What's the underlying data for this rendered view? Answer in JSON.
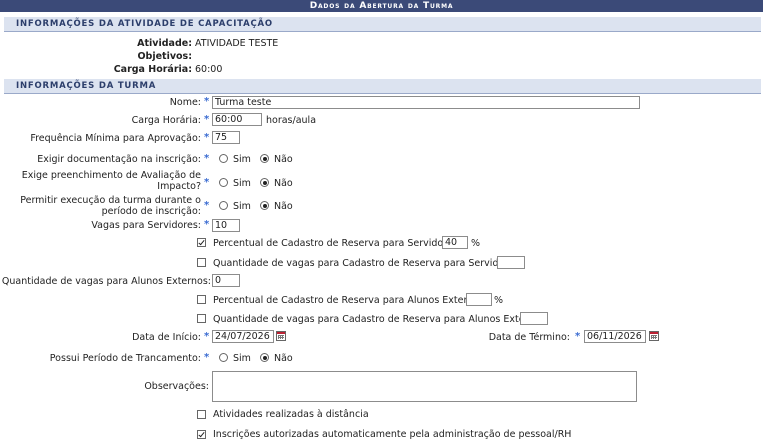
{
  "header": {
    "title": "Dados da Abertura da Turma"
  },
  "activity_info": {
    "section_title": "Informações da Atividade de Capacitação",
    "atividade_label": "Atividade:",
    "atividade_value": "ATIVIDADE TESTE",
    "objetivos_label": "Objetivos:",
    "objetivos_value": "",
    "carga_label": "Carga Horária:",
    "carga_value": "60:00"
  },
  "turma_info": {
    "section_title": "Informações da Turma",
    "nome": {
      "label": "Nome:",
      "value": "Turma teste"
    },
    "carga": {
      "label": "Carga Horária:",
      "value": "60:00",
      "unit": "horas/aula"
    },
    "frequencia": {
      "label": "Frequência Mínima para Aprovação:",
      "value": "75"
    },
    "exigir_doc": {
      "label": "Exigir documentação na inscrição:",
      "sim": "Sim",
      "nao": "Não",
      "selected": "Não"
    },
    "exige_aval_1": "Exige preenchimento de Avaliação de",
    "exige_aval_2": "Impacto?",
    "exige_aval": {
      "sim": "Sim",
      "nao": "Não",
      "selected": "Não"
    },
    "permitir_1": "Permitir execução da turma durante o",
    "permitir_2": "período de inscrição:",
    "permitir": {
      "sim": "Sim",
      "nao": "Não",
      "selected": "Não"
    },
    "vagas_servidores": {
      "label": "Vagas para Servidores:",
      "value": "10"
    },
    "perc_reserva_serv": {
      "label": "Percentual de Cadastro de Reserva para Servidores:",
      "value": "40",
      "unit": "%",
      "checked": true
    },
    "qtd_reserva_serv": {
      "label": "Quantidade de vagas para Cadastro de Reserva para Servidores:",
      "value": "",
      "checked": false
    },
    "vagas_externos": {
      "label": "Quantidade de vagas para Alunos Externos:",
      "value": "0"
    },
    "perc_reserva_ext": {
      "label": "Percentual de Cadastro de Reserva para Alunos Externos:",
      "value": "",
      "unit": "%",
      "checked": false
    },
    "qtd_reserva_ext": {
      "label": "Quantidade de vagas para Cadastro de Reserva para Alunos Externos:",
      "value": "",
      "checked": false
    },
    "data_inicio": {
      "label": "Data de Início:",
      "value": "24/07/2026"
    },
    "data_termino": {
      "label": "Data de Término:",
      "value": "06/11/2026"
    },
    "trancamento": {
      "label": "Possui Período de Trancamento:",
      "sim": "Sim",
      "nao": "Não",
      "selected": "Não"
    },
    "observacoes": {
      "label": "Observações:",
      "value": ""
    },
    "atividades_distancia": {
      "label": "Atividades realizadas à distância",
      "checked": false
    },
    "inscricoes_auto": {
      "label": "Inscrições autorizadas automaticamente pela administração de pessoal/RH",
      "checked": true
    }
  },
  "colors": {
    "header_bg": "#3b4a78",
    "section_bg": "#dce3f0",
    "required_star": "#3a6bd1"
  }
}
